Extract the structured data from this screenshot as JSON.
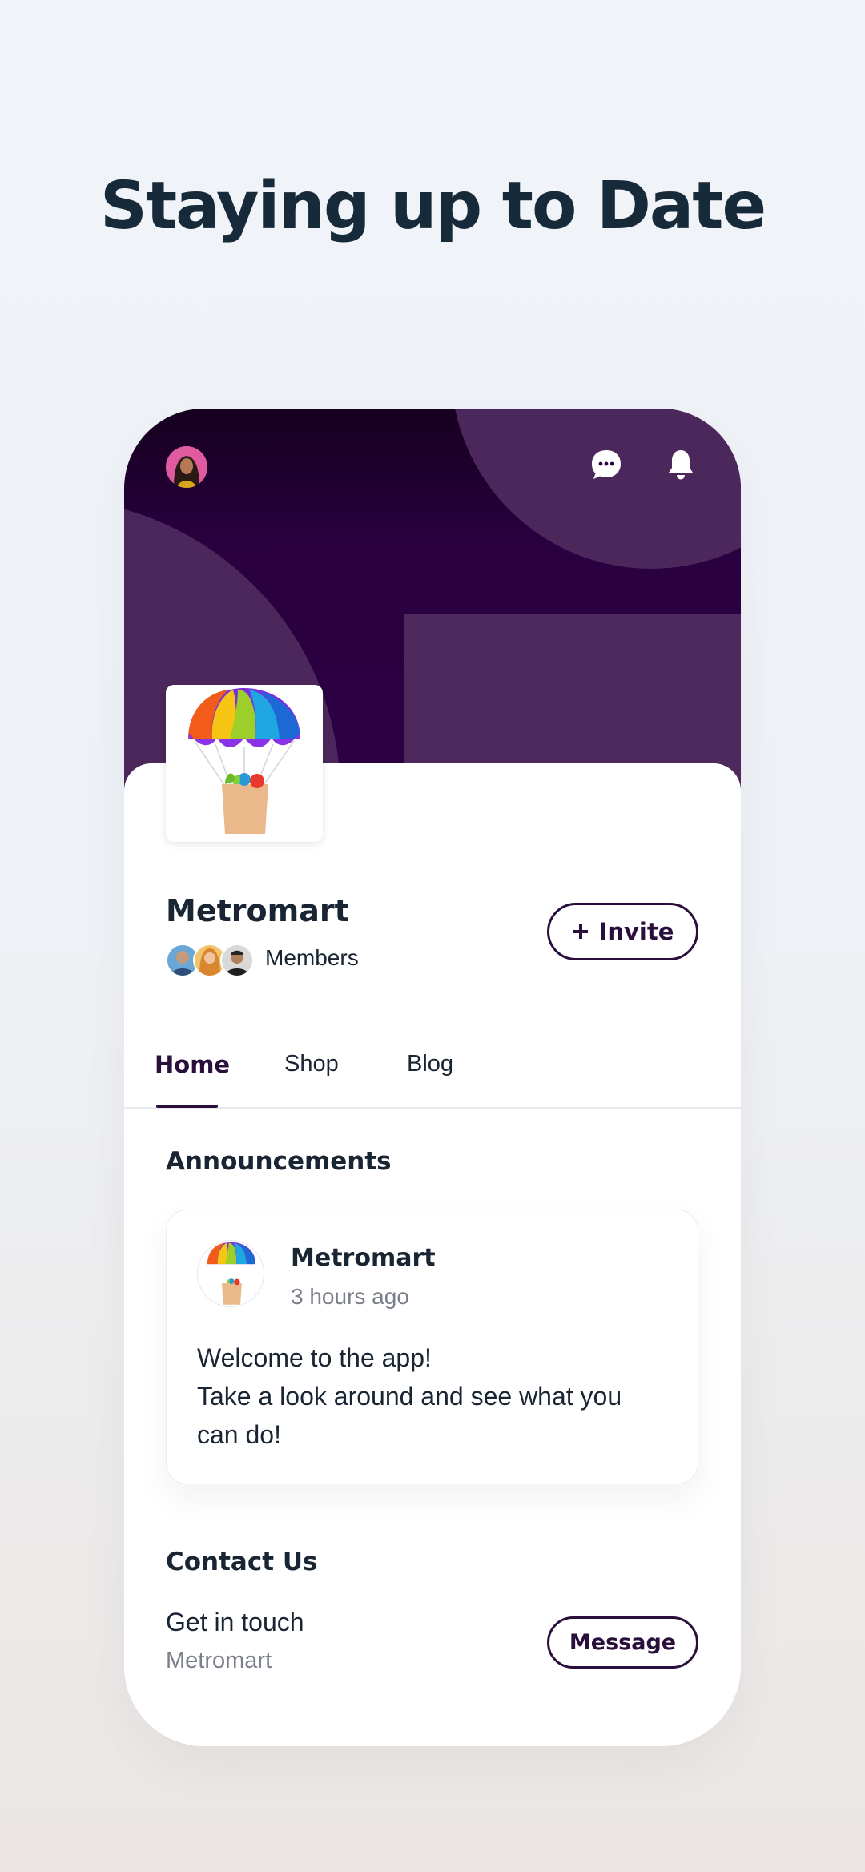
{
  "headline": "Staying up to Date",
  "group": {
    "name": "Metromart",
    "members_label": "Members",
    "invite_label": "Invite"
  },
  "tabs": [
    {
      "label": "Home",
      "active": true
    },
    {
      "label": "Shop",
      "active": false
    },
    {
      "label": "Blog",
      "active": false
    }
  ],
  "announcements": {
    "title": "Announcements",
    "post": {
      "author": "Metromart",
      "time": "3 hours ago",
      "body_lines": [
        "Welcome to the app!",
        "Take a look around and see what you",
        "can do!"
      ]
    }
  },
  "contact": {
    "title": "Contact Us",
    "line1": "Get in touch",
    "line2": "Metromart",
    "message_label": "Message"
  },
  "colors": {
    "cover_dark": "#2d0043",
    "cover_shape": "#4c275c",
    "accent": "#2a0f3c",
    "headline": "#162a3a"
  },
  "icons": [
    "profile-avatar",
    "chat-bubble-icon",
    "bell-icon",
    "plus-icon",
    "parachute-logo"
  ]
}
